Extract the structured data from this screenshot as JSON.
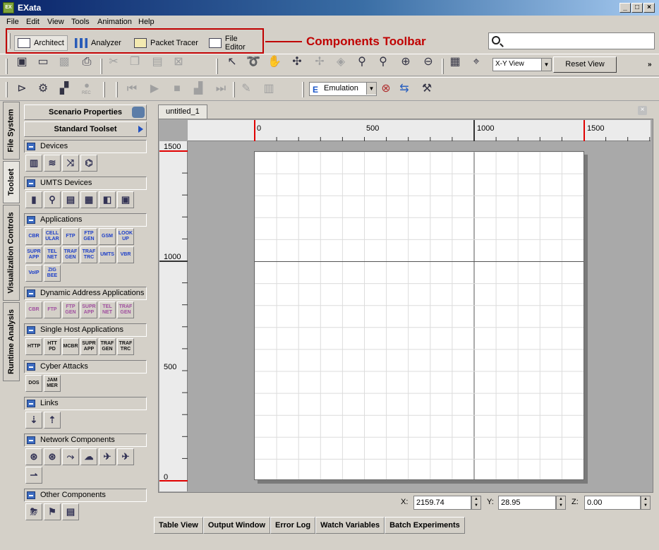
{
  "window": {
    "title": "EXata",
    "app_icon": "EX"
  },
  "menu": [
    "File",
    "Edit",
    "View",
    "Tools",
    "Animation",
    "Help"
  ],
  "components_toolbar": {
    "tabs": [
      {
        "label": "Architect",
        "icon": "architect-icon"
      },
      {
        "label": "Analyzer",
        "icon": "bar-chart-icon"
      },
      {
        "label": "Packet Tracer",
        "icon": "packet-tracer-icon"
      },
      {
        "label": "File Editor",
        "icon": "file-editor-icon"
      }
    ],
    "selected": "Architect"
  },
  "annotation": {
    "label": "Components Toolbar",
    "color": "#c00000"
  },
  "search": {
    "placeholder": ""
  },
  "toolbar": {
    "view_select": "X-Y View",
    "reset_view": "Reset View",
    "more": "»",
    "mode_select": "Emulation",
    "rec_label": "REC"
  },
  "vertical_tabs": [
    "File System",
    "Toolset",
    "Visualization Controls",
    "Runtime Analysis"
  ],
  "panel": {
    "scenario_properties": "Scenario Properties",
    "standard_toolset": "Standard Toolset",
    "categories": [
      {
        "name": "Devices",
        "buttons": [
          {
            "l": "▥",
            "c": "ico"
          },
          {
            "l": "≋",
            "c": "ico"
          },
          {
            "l": "⤨",
            "c": "ico"
          },
          {
            "l": "⌬",
            "c": "ico"
          }
        ]
      },
      {
        "name": "UMTS Devices",
        "buttons": [
          {
            "l": "▮",
            "c": "ico"
          },
          {
            "l": "⚲",
            "c": "ico"
          },
          {
            "l": "▤",
            "c": "ico"
          },
          {
            "l": "▦",
            "c": "ico"
          },
          {
            "l": "◧",
            "c": "ico"
          },
          {
            "l": "▣",
            "c": "ico"
          }
        ]
      },
      {
        "name": "Applications",
        "buttons": [
          {
            "l": "CBR"
          },
          {
            "l": "CELL ULAR"
          },
          {
            "l": "FTP"
          },
          {
            "l": "FTP GEN"
          },
          {
            "l": "GSM"
          },
          {
            "l": "LOOK UP"
          },
          {
            "l": "SUPR APP"
          },
          {
            "l": "TEL NET"
          },
          {
            "l": "TRAF GEN"
          },
          {
            "l": "TRAF TRC"
          },
          {
            "l": "UMTS"
          },
          {
            "l": "VBR"
          },
          {
            "l": "VoIP"
          },
          {
            "l": "ZIG BEE"
          }
        ]
      },
      {
        "name": "Dynamic Address Applications",
        "buttons": [
          {
            "l": "CBR",
            "c": "purple"
          },
          {
            "l": "FTP",
            "c": "purple"
          },
          {
            "l": "FTP GEN",
            "c": "purple"
          },
          {
            "l": "SUPR APP",
            "c": "purple"
          },
          {
            "l": "TEL NET",
            "c": "purple"
          },
          {
            "l": "TRAF GEN",
            "c": "purple"
          }
        ]
      },
      {
        "name": "Single Host Applications",
        "buttons": [
          {
            "l": "HTTP",
            "c": "black"
          },
          {
            "l": "HTT PD",
            "c": "black"
          },
          {
            "l": "MCBR",
            "c": "black"
          },
          {
            "l": "SUPR APP",
            "c": "black"
          },
          {
            "l": "TRAF GEN",
            "c": "black"
          },
          {
            "l": "TRAF TRC",
            "c": "black"
          }
        ]
      },
      {
        "name": "Cyber Attacks",
        "buttons": [
          {
            "l": "DOS",
            "c": "black"
          },
          {
            "l": "JAM MER",
            "c": "black"
          }
        ]
      },
      {
        "name": "Links",
        "buttons": [
          {
            "l": "⇣",
            "c": "ico"
          },
          {
            "l": "⇡",
            "c": "ico"
          }
        ]
      },
      {
        "name": "Network Components",
        "buttons": [
          {
            "l": "⊛",
            "c": "ico"
          },
          {
            "l": "⊛",
            "c": "ico"
          },
          {
            "l": "⤳",
            "c": "ico"
          },
          {
            "l": "☁",
            "c": "ico"
          },
          {
            "l": "✈",
            "c": "ico"
          },
          {
            "l": "✈",
            "c": "ico"
          },
          {
            "l": "⇀",
            "c": "ico"
          }
        ]
      },
      {
        "name": "Other Components",
        "buttons": [
          {
            "l": "⛈",
            "c": "ico"
          },
          {
            "l": "⚑",
            "c": "ico"
          },
          {
            "l": "▤",
            "c": "ico"
          }
        ]
      }
    ]
  },
  "document": {
    "tab": "untitled_1"
  },
  "rulers": {
    "h_labels": [
      "0",
      "500",
      "1000",
      "1500"
    ],
    "v_labels": [
      "1500",
      "1000",
      "500",
      "0"
    ]
  },
  "coords": {
    "x_label": "X:",
    "x": "2159.74",
    "y_label": "Y:",
    "y": "28.95",
    "z_label": "Z:",
    "z": "0.00"
  },
  "bottom_tabs": [
    "Table View",
    "Output Window",
    "Error Log",
    "Watch Variables",
    "Batch Experiments"
  ]
}
